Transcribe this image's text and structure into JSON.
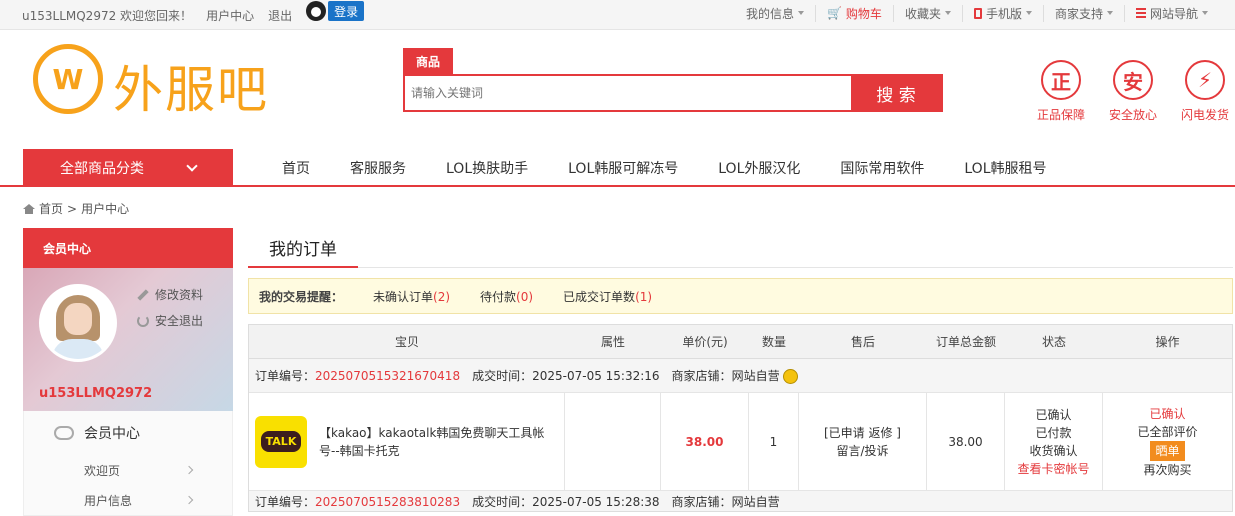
{
  "topbar": {
    "user": "u153LLMQ2972",
    "welcome": "欢迎您回来！",
    "user_center": "用户中心",
    "logout": "退出",
    "qq_login": "登录",
    "my_info": "我的信息",
    "cart": "购物车",
    "favorites": "收藏夹",
    "mobile": "手机版",
    "merchant": "商家支持",
    "site_nav": "网站导航"
  },
  "header": {
    "logo_text": "外服吧",
    "logo_mark": "W",
    "search_tab": "商品",
    "search_placeholder": "请输入关键词",
    "search_button": "搜 索",
    "guarantees": [
      {
        "glyph": "正",
        "label": "正品保障"
      },
      {
        "glyph": "安",
        "label": "安全放心"
      },
      {
        "glyph": "⚡",
        "label": "闪电发货"
      }
    ]
  },
  "nav": {
    "all_categories": "全部商品分类",
    "links": [
      "首页",
      "客服服务",
      "LOL换肤助手",
      "LOL韩服可解冻号",
      "LOL外服汉化",
      "国际常用软件",
      "LOL韩服租号"
    ]
  },
  "breadcrumb": {
    "home": "首页",
    "sep": ">",
    "current": "用户中心"
  },
  "sidebar": {
    "title": "会员中心",
    "edit_profile": "修改资料",
    "safe_logout": "安全退出",
    "username": "u153LLMQ2972",
    "menu_title": "会员中心",
    "items": [
      "欢迎页",
      "用户信息"
    ]
  },
  "main": {
    "tab": "我的订单",
    "notice": {
      "lead": "我的交易提醒：",
      "unconfirmed": "未确认订单",
      "unconfirmed_n": "(2)",
      "pending": "待付款",
      "pending_n": "(0)",
      "done": "已成交订单数",
      "done_n": "(1)"
    },
    "columns": [
      "宝贝",
      "属性",
      "单价(元)",
      "数量",
      "售后",
      "订单总金额",
      "状态",
      "操作"
    ],
    "orders": [
      {
        "no_label": "订单编号：",
        "no": "2025070515321670418",
        "time_label": "成交时间：",
        "time": "2025-07-05 15:32:16",
        "shop_label": "商家店铺：",
        "shop": "网站自营",
        "thumb": "TALK",
        "title": "【kakao】kakaotalk韩国免费聊天工具帐号--韩国卡托克",
        "price": "38.00",
        "qty": "1",
        "after1": "[已申请 返修 ]",
        "after2": "留言/投诉",
        "total": "38.00",
        "status1": "已确认",
        "status2": "已付款",
        "status3": "收货确认",
        "status_link": "查看卡密帐号",
        "op1": "已确认",
        "op2": "已全部评价",
        "op3": "晒单",
        "op4": "再次购买"
      }
    ],
    "next_order": {
      "no_label": "订单编号：",
      "no": "2025070515283810283",
      "time_label": "成交时间：",
      "time": "2025-07-05 15:28:38",
      "shop_label": "商家店铺：",
      "shop": "网站自营"
    }
  }
}
